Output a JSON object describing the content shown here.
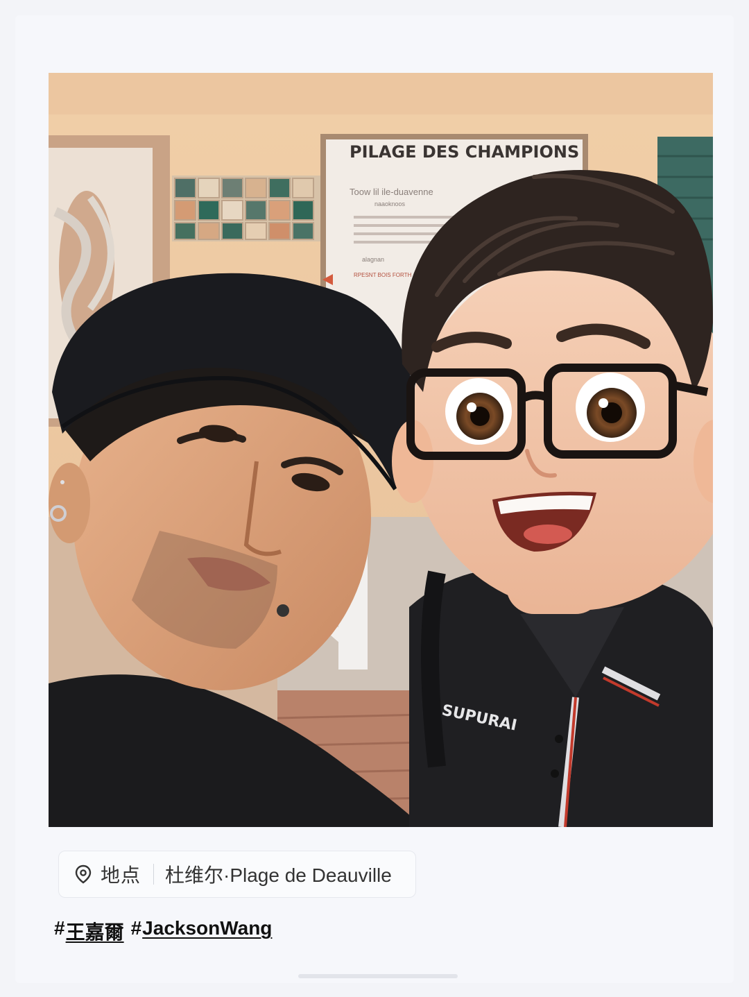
{
  "photo": {
    "sign_title": "PILAGE DES CHAMPIONS",
    "sign_subtitle_lines": [
      "Toow lil ile-duavenne",
      "naaoknoos"
    ],
    "sign_small_lines": [
      "alagnan",
      "RPESNT BOIS FORTH"
    ],
    "shirt_logo": "SUPURAI"
  },
  "location": {
    "icon": "location-pin-icon",
    "label": "地点",
    "value": "杜维尔·Plage de Deauville"
  },
  "hashtags": [
    {
      "hash": "#",
      "text": "王嘉爾"
    },
    {
      "hash": "#",
      "text": "JacksonWang"
    }
  ],
  "colors": {
    "background": "#f3f4f8",
    "chip_border": "#e6e8ee",
    "text": "#333333",
    "hashtag": "#111111"
  }
}
